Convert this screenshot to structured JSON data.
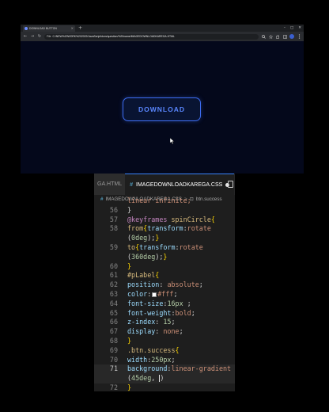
{
  "browser": {
    "tab_title": "DOWNLOAD BUTTON",
    "tab_close": "×",
    "new_tab": "+",
    "window_controls": [
      "–",
      "□",
      "✕"
    ],
    "nav": {
      "back": "←",
      "forward": "→",
      "reload": "↻"
    },
    "address": {
      "scheme_label": "File",
      "url": "C:/NEW%20WORK%202022/JavaScript/dom/question/%20name/IMAGEDOWNLOADKAREGA.HTML"
    },
    "page": {
      "download_label": "DOWNLOAD"
    },
    "colors": {
      "page_bg": "#04081b",
      "button_accent": "#3d6cf0"
    }
  },
  "editor": {
    "tabs": [
      {
        "label": "GA.HTML",
        "active": false
      },
      {
        "icon": "#",
        "label": "IMAGEDOWNLOADKAREGA.CSS",
        "active": true,
        "unsaved": true
      }
    ],
    "breadcrumb": {
      "icon": "#",
      "file": "IMAGEDOWNLOADKAREGA.CSS",
      "separator": ">",
      "symbol_icon": "⊡",
      "symbol": "btn.success"
    },
    "lines": [
      {
        "n": "",
        "parts": [
          [
            "linear infinite;",
            "val"
          ]
        ]
      },
      {
        "n": "56",
        "parts": [
          [
            "}",
            "pun"
          ]
        ]
      },
      {
        "n": "57",
        "parts": [
          [
            "@keyframes ",
            "kw"
          ],
          [
            "spinCircle",
            "sel"
          ],
          [
            "{",
            "brace"
          ]
        ]
      },
      {
        "n": "58",
        "parts": [
          [
            "from",
            "sel"
          ],
          [
            "{",
            "brace"
          ],
          [
            "transform",
            "prop"
          ],
          [
            ":",
            "pun"
          ],
          [
            "rotate",
            "val"
          ]
        ],
        "wrap": [
          [
            "(",
            "pun"
          ],
          [
            "0deg",
            "num"
          ],
          [
            ");",
            "pun"
          ],
          [
            "}",
            "brace"
          ]
        ]
      },
      {
        "n": "59",
        "parts": [
          [
            "to",
            "sel"
          ],
          [
            "{",
            "brace"
          ],
          [
            "transform",
            "prop"
          ],
          [
            ":",
            "pun"
          ],
          [
            "rotate",
            "val"
          ]
        ],
        "wrap": [
          [
            "(",
            "pun"
          ],
          [
            "360deg",
            "num"
          ],
          [
            ");",
            "pun"
          ],
          [
            "}",
            "brace"
          ]
        ]
      },
      {
        "n": "60",
        "parts": [
          [
            "}",
            "brace"
          ]
        ]
      },
      {
        "n": "61",
        "parts": [
          [
            "#pLabel",
            "sel"
          ],
          [
            "{",
            "brace"
          ]
        ]
      },
      {
        "n": "62",
        "parts": [
          [
            "position",
            "prop"
          ],
          [
            ": ",
            "pun"
          ],
          [
            "absolute",
            "val"
          ],
          [
            ";",
            "pun"
          ]
        ]
      },
      {
        "n": "63",
        "parts": [
          [
            "color",
            "prop"
          ],
          [
            ":",
            "pun"
          ],
          [
            "SWATCH",
            "swatch"
          ],
          [
            "#fff",
            "val"
          ],
          [
            ";",
            "pun"
          ]
        ]
      },
      {
        "n": "64",
        "parts": [
          [
            "font-size",
            "prop"
          ],
          [
            ":",
            "pun"
          ],
          [
            "16px",
            "num"
          ],
          [
            " ;",
            "pun"
          ]
        ]
      },
      {
        "n": "65",
        "parts": [
          [
            "font-weight",
            "prop"
          ],
          [
            ":",
            "pun"
          ],
          [
            "bold",
            "val"
          ],
          [
            ";",
            "pun"
          ]
        ]
      },
      {
        "n": "66",
        "parts": [
          [
            "z-index",
            "prop"
          ],
          [
            ": ",
            "pun"
          ],
          [
            "15",
            "num"
          ],
          [
            ";",
            "pun"
          ]
        ]
      },
      {
        "n": "67",
        "parts": [
          [
            "display",
            "prop"
          ],
          [
            ": ",
            "pun"
          ],
          [
            "none",
            "val"
          ],
          [
            ";",
            "pun"
          ]
        ]
      },
      {
        "n": "68",
        "parts": [
          [
            "}",
            "brace"
          ]
        ]
      },
      {
        "n": "69",
        "parts": [
          [
            ".btn.success",
            "sel"
          ],
          [
            "{",
            "brace"
          ]
        ]
      },
      {
        "n": "70",
        "parts": [
          [
            "width",
            "prop"
          ],
          [
            ":",
            "pun"
          ],
          [
            "250px",
            "num"
          ],
          [
            ";",
            "pun"
          ]
        ]
      },
      {
        "n": "71",
        "current": true,
        "parts": [
          [
            "background",
            "prop"
          ],
          [
            ":",
            "pun"
          ],
          [
            "linear-gradient",
            "val"
          ]
        ],
        "wrap": [
          [
            "(",
            "pun"
          ],
          [
            "45deg",
            "num"
          ],
          [
            ", ",
            "pun"
          ],
          [
            "CARET",
            "caret"
          ],
          [
            ")",
            "pun"
          ]
        ]
      },
      {
        "n": "72",
        "parts": [
          [
            "}",
            "brace"
          ]
        ]
      }
    ]
  }
}
